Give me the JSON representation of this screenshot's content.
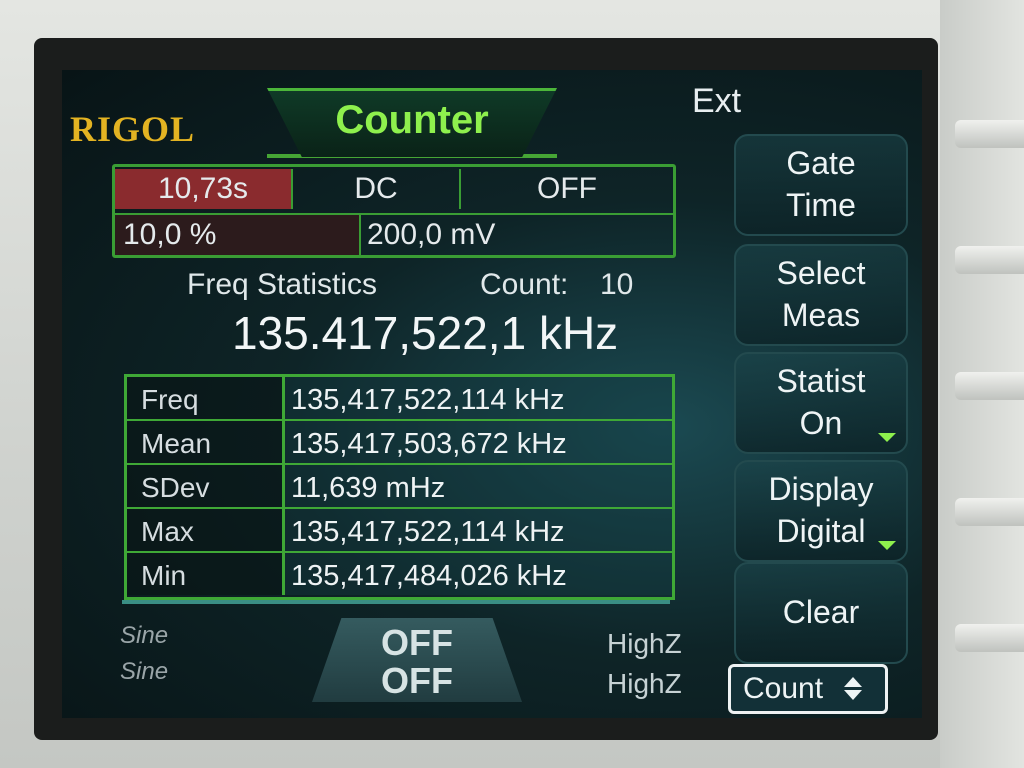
{
  "brand": "RIGOL",
  "mode_title": "Counter",
  "trigger_source": "Ext",
  "params": {
    "gate_time": "10,73s",
    "coupling": "DC",
    "hf_filter": "OFF",
    "duty": "10,0 %",
    "trigger_level": "200,0 mV"
  },
  "statistics": {
    "header": "Freq Statistics",
    "count_label": "Count:",
    "count_value": "10",
    "main_reading": "135.417,522,1 kHz",
    "rows": [
      {
        "label": "Freq",
        "value": "135,417,522,114 kHz"
      },
      {
        "label": "Mean",
        "value": "135,417,503,672 kHz"
      },
      {
        "label": "SDev",
        "value": "11,639 mHz"
      },
      {
        "label": "Max",
        "value": "135,417,522,114 kHz"
      },
      {
        "label": "Min",
        "value": "135,417,484,026 kHz"
      }
    ]
  },
  "channels": {
    "ch1_info": "Sine",
    "ch2_info": "Sine",
    "ch1_output": "OFF",
    "ch2_output": "OFF",
    "ch1_load": "HighZ",
    "ch2_load": "HighZ"
  },
  "softkeys": [
    {
      "line1": "Gate",
      "line2": "Time",
      "marker": false
    },
    {
      "line1": "Select",
      "line2": "Meas",
      "marker": false
    },
    {
      "line1": "Statist",
      "line2": "On",
      "marker": true
    },
    {
      "line1": "Display",
      "line2": "Digital",
      "marker": true
    },
    {
      "line1": "Clear",
      "line2": "",
      "marker": false
    }
  ],
  "menu_selector": "Count",
  "colors": {
    "accent_green": "#8ef04d",
    "grid_green": "#3fa836",
    "brand_gold": "#e3b322",
    "gate_highlight": "#8a2b2e"
  }
}
